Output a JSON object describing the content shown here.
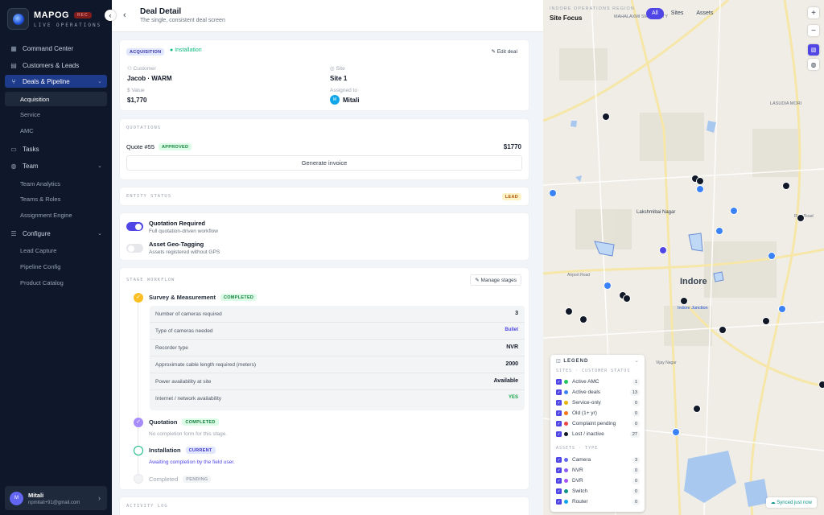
{
  "brand": {
    "name": "MAPOG",
    "rec": "REC",
    "subtitle": "LIVE OPERATIONS"
  },
  "sidebar": {
    "items": [
      {
        "label": "Command Center"
      },
      {
        "label": "Customers & Leads"
      },
      {
        "label": "Deals & Pipeline"
      },
      {
        "label": "Tasks"
      },
      {
        "label": "Team"
      },
      {
        "label": "Configure"
      }
    ],
    "deals_sub": [
      "Acquisition",
      "Service",
      "AMC"
    ],
    "team_sub": [
      "Team Analytics",
      "Teams & Roles",
      "Assignment Engine"
    ],
    "configure_sub": [
      "Lead Capture",
      "Pipeline Config",
      "Product Catalog"
    ],
    "user": {
      "initial": "M",
      "name": "Mitali",
      "email": "npmitali+91@gmail.com"
    }
  },
  "header": {
    "title": "Deal Detail",
    "subtitle": "The single, consistent deal screen"
  },
  "deal": {
    "type_badge": "ACQUISITION",
    "stage_badge": "Installation",
    "edit": "✎ Edit deal",
    "customer_label": "Customer",
    "customer": "Jacob · WARM",
    "site_label": "Site",
    "site": "Site 1",
    "value_label": "Value",
    "value": "$1,770",
    "assigned_label": "Assigned to",
    "assigned": "Mitali",
    "assigned_initial": "M"
  },
  "quotations": {
    "section": "QUOTATIONS",
    "quote": "Quote #55",
    "status": "APPROVED",
    "amount": "$1770",
    "button": "Generate invoice"
  },
  "entity": {
    "section": "ENTITY STATUS",
    "badge": "LEAD"
  },
  "toggles": [
    {
      "title": "Quotation Required",
      "desc": "Full quotation-driven workflow",
      "on": true
    },
    {
      "title": "Asset Geo-Tagging",
      "desc": "Assets registered without GPS",
      "on": false
    }
  ],
  "workflow": {
    "section": "STAGE WORKFLOW",
    "manage": "✎ Manage stages",
    "stages": [
      {
        "name": "Survey & Measurement",
        "status": "COMPLETED"
      },
      {
        "name": "Quotation",
        "status": "COMPLETED",
        "note": "No completion form for this stage."
      },
      {
        "name": "Installation",
        "status": "CURRENT",
        "note": "Awaiting completion by the field user."
      },
      {
        "name": "Completed",
        "status": "PENDING"
      }
    ],
    "fields": [
      {
        "k": "Number of cameras required",
        "v": "3"
      },
      {
        "k": "Type of cameras needed",
        "v": "Bullet"
      },
      {
        "k": "Recorder type",
        "v": "NVR"
      },
      {
        "k": "Approximate cable length required (meters)",
        "v": "2000"
      },
      {
        "k": "Power availability at site",
        "v": "Available"
      },
      {
        "k": "Internet / network availability",
        "v": "YES"
      }
    ]
  },
  "activity": {
    "section": "ACTIVITY LOG"
  },
  "map": {
    "region": "INDORE OPERATIONS REGION",
    "title": "Site Focus",
    "filters": [
      "All",
      "Sites",
      "Assets"
    ],
    "labels": {
      "indore": "Indore",
      "vijay": "Vijay Nagar",
      "lakshmi": "Lakshmibai Nagar",
      "smart": "MAHALAXMI SMART CITY",
      "junction": "Indore Junction",
      "airport": "Airport Road",
      "lasudia": "LASUDIA MORI",
      "ring": "Ring Road"
    },
    "legend": {
      "title": "LEGEND",
      "customer_section": "SITES · CUSTOMER STATUS",
      "asset_section": "ASSETS · TYPE",
      "customer": [
        {
          "label": "Active AMC",
          "count": "1",
          "color": "#22c55e"
        },
        {
          "label": "Active deals",
          "count": "13",
          "color": "#3b82f6"
        },
        {
          "label": "Service-only",
          "count": "0",
          "color": "#eab308"
        },
        {
          "label": "Old (1+ yr)",
          "count": "0",
          "color": "#f97316"
        },
        {
          "label": "Complaint pending",
          "count": "0",
          "color": "#ef4444"
        },
        {
          "label": "Lost / inactive",
          "count": "27",
          "color": "#111827"
        }
      ],
      "assets": [
        {
          "label": "Camera",
          "count": "3",
          "color": "#6366f1"
        },
        {
          "label": "NVR",
          "count": "0",
          "color": "#8b5cf6"
        },
        {
          "label": "DVR",
          "count": "0",
          "color": "#a855f7"
        },
        {
          "label": "Switch",
          "count": "0",
          "color": "#0d9488"
        },
        {
          "label": "Router",
          "count": "0",
          "color": "#0ea5e9"
        }
      ]
    },
    "synced": "Synced just now"
  }
}
